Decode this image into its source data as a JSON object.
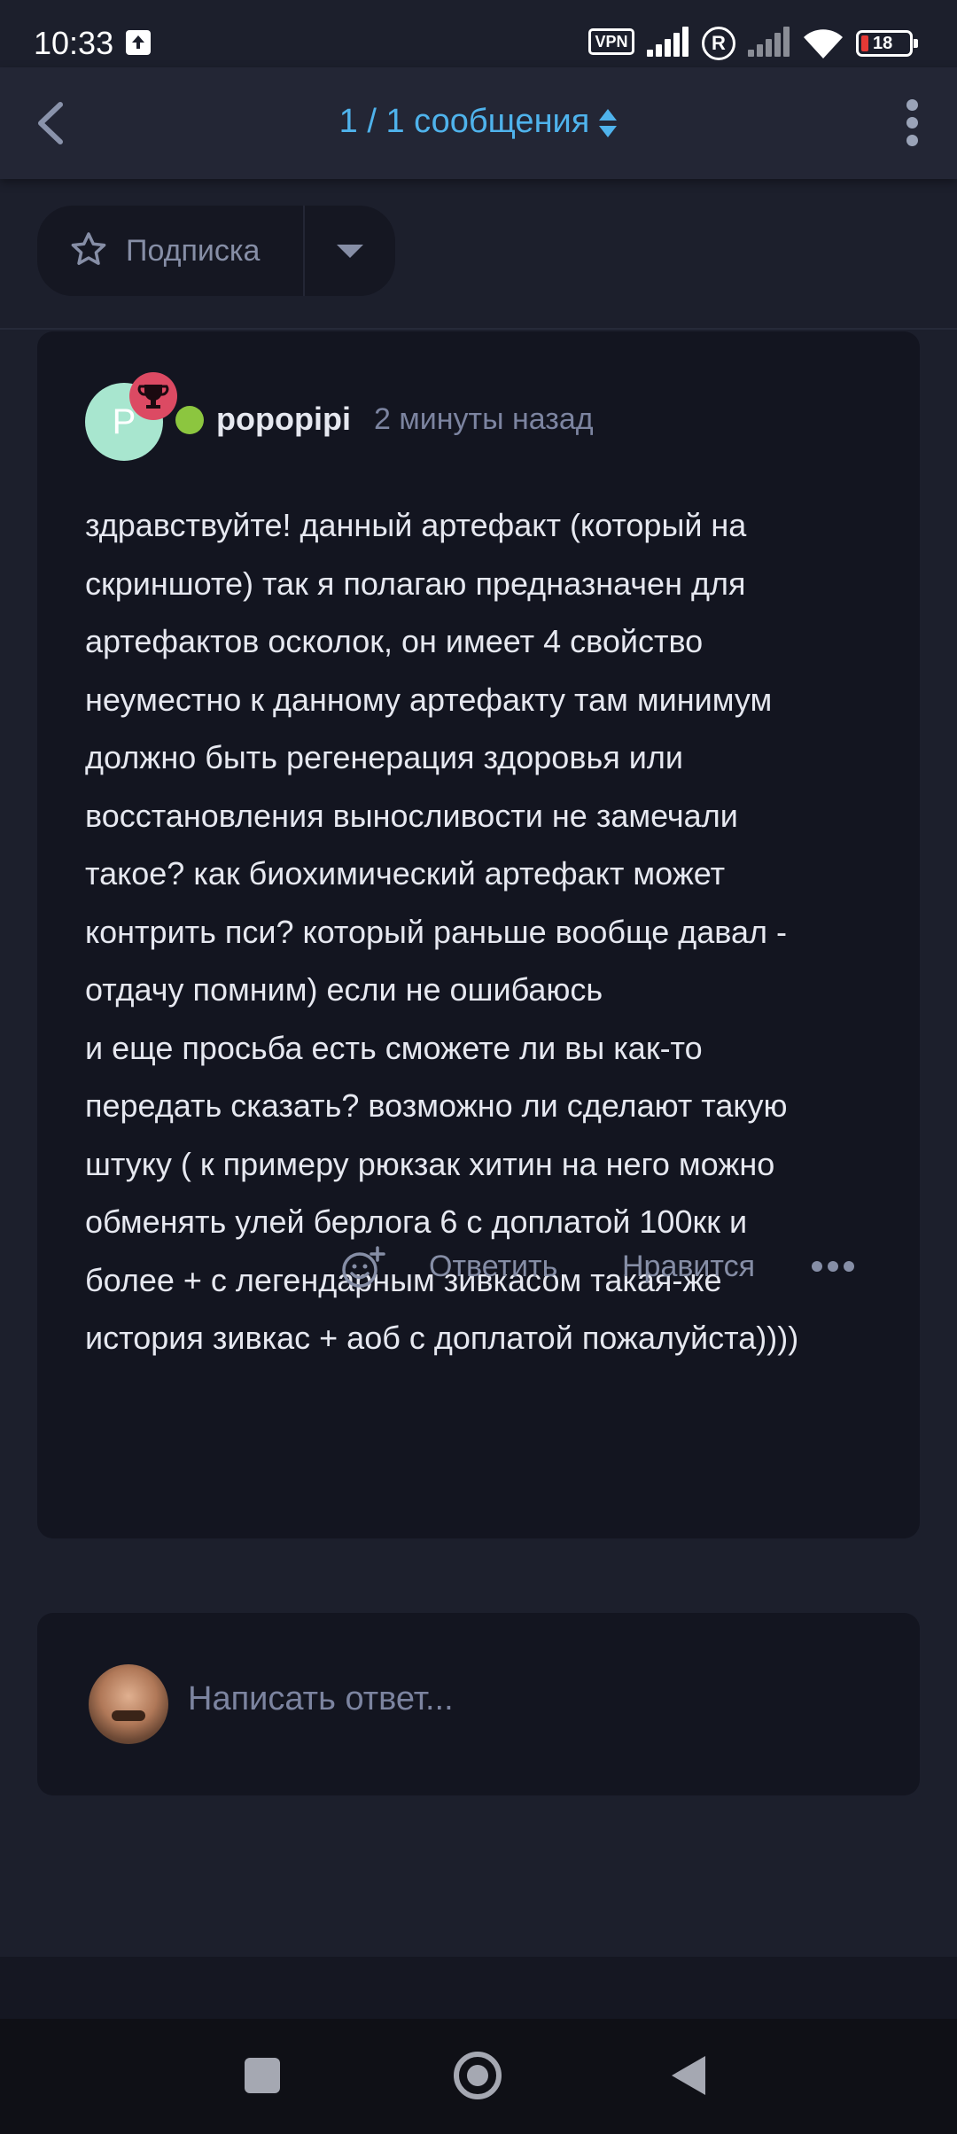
{
  "status_bar": {
    "time": "10:33",
    "vpn": "VPN",
    "roaming": "R",
    "battery": "18"
  },
  "header": {
    "title": "1 / 1 сообщения",
    "icons": [
      "back-chevron-icon",
      "sort-icon",
      "more-vertical-icon"
    ]
  },
  "subscribe": {
    "label": "Подписка",
    "icons": [
      "star-icon",
      "dropdown-arrow-icon"
    ]
  },
  "post": {
    "avatar_letter": "P",
    "author": "popopipi",
    "time_ago": "2 минуты назад",
    "lines": [
      "здравствуйте! данный артефакт (который на",
      "скриншоте) так я полагаю предназначен для",
      "артефактов осколок, он имеет 4 свойство",
      "неуместно к данному артефакту там минимум",
      "должно быть регенерация здоровья или",
      "восстановления выносливости не замечали",
      "такое? как биохимический артефакт может",
      "контрить пси? который раньше вообще давал -",
      "отдачу помним) если не ошибаюсь",
      "и еще просьба есть сможете ли вы как-то",
      "передать сказать? возможно ли сделают такую",
      "штуку ( к примеру рюкзак хитин на него можно",
      "обменять улей берлога 6 с доплатой 100кк и",
      "более + с легендарным зивкасом такая-же",
      "история зивкас + аоб с доплатой пожалуйста))))"
    ],
    "actions": {
      "reply": "Ответить",
      "like": "Нравится"
    }
  },
  "reply_box": {
    "placeholder": "Написать ответ..."
  },
  "colors": {
    "accent": "#4fb3ec",
    "background": "#1c1f2c",
    "card": "#131520",
    "online": "#8cc63f",
    "badge": "#dc4a63"
  }
}
